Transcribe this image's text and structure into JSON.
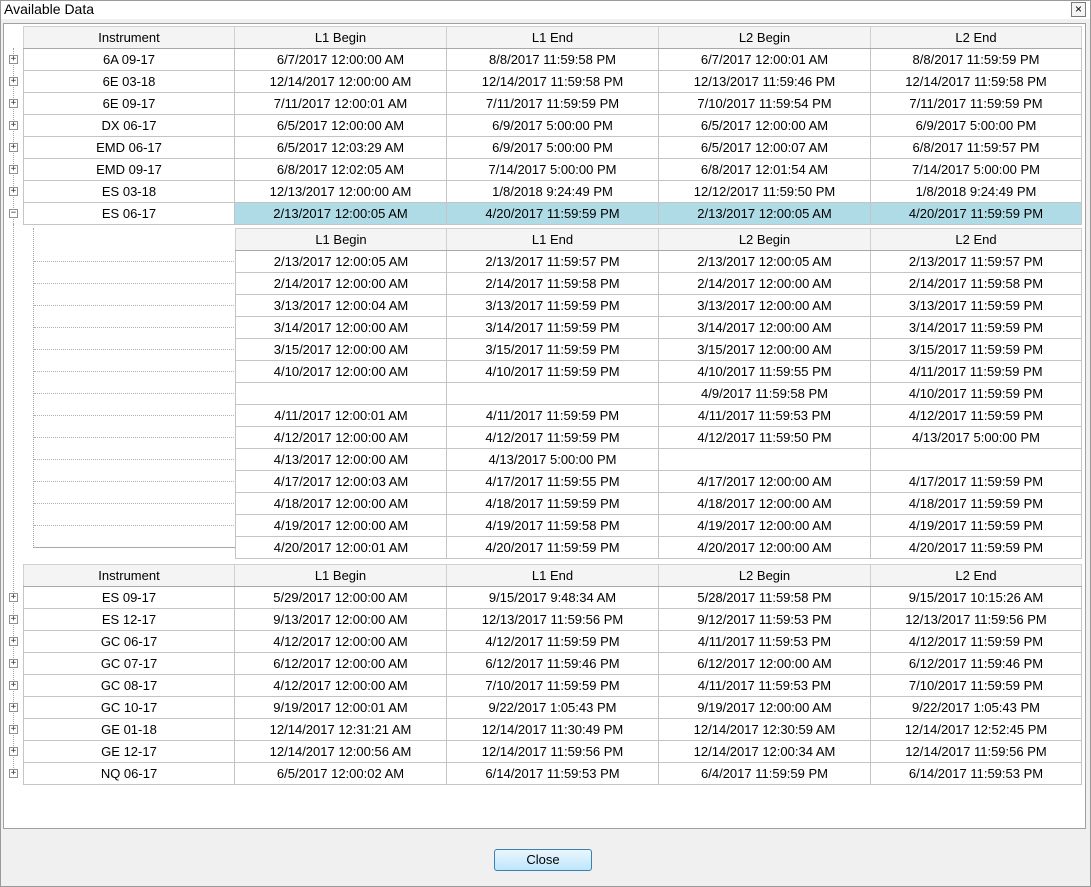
{
  "window": {
    "title": "Available Data",
    "close_glyph": "×"
  },
  "columns": [
    "Instrument",
    "L1 Begin",
    "L1 End",
    "L2 Begin",
    "L2 End"
  ],
  "child_columns": [
    "L1 Begin",
    "L1 End",
    "L2 Begin",
    "L2 End"
  ],
  "rows_top": [
    [
      "6A 09-17",
      "6/7/2017 12:00:00 AM",
      "8/8/2017 11:59:58 PM",
      "6/7/2017 12:00:01 AM",
      "8/8/2017 11:59:59 PM"
    ],
    [
      "6E 03-18",
      "12/14/2017 12:00:00 AM",
      "12/14/2017 11:59:58 PM",
      "12/13/2017 11:59:46 PM",
      "12/14/2017 11:59:58 PM"
    ],
    [
      "6E 09-17",
      "7/11/2017 12:00:01 AM",
      "7/11/2017 11:59:59 PM",
      "7/10/2017 11:59:54 PM",
      "7/11/2017 11:59:59 PM"
    ],
    [
      "DX 06-17",
      "6/5/2017 12:00:00 AM",
      "6/9/2017 5:00:00 PM",
      "6/5/2017 12:00:00 AM",
      "6/9/2017 5:00:00 PM"
    ],
    [
      "EMD 06-17",
      "6/5/2017 12:03:29 AM",
      "6/9/2017 5:00:00 PM",
      "6/5/2017 12:00:07 AM",
      "6/8/2017 11:59:57 PM"
    ],
    [
      "EMD 09-17",
      "6/8/2017 12:02:05 AM",
      "7/14/2017 5:00:00 PM",
      "6/8/2017 12:01:54 AM",
      "7/14/2017 5:00:00 PM"
    ],
    [
      "ES 03-18",
      "12/13/2017 12:00:00 AM",
      "1/8/2018 9:24:49 PM",
      "12/12/2017 11:59:50 PM",
      "1/8/2018 9:24:49 PM"
    ],
    [
      "ES 06-17",
      "2/13/2017 12:00:05 AM",
      "4/20/2017 11:59:59 PM",
      "2/13/2017 12:00:05 AM",
      "4/20/2017 11:59:59 PM"
    ]
  ],
  "selected_row_index": 7,
  "child_rows": [
    [
      "2/13/2017 12:00:05 AM",
      "2/13/2017 11:59:57 PM",
      "2/13/2017 12:00:05 AM",
      "2/13/2017 11:59:57 PM"
    ],
    [
      "2/14/2017 12:00:00 AM",
      "2/14/2017 11:59:58 PM",
      "2/14/2017 12:00:00 AM",
      "2/14/2017 11:59:58 PM"
    ],
    [
      "3/13/2017 12:00:04 AM",
      "3/13/2017 11:59:59 PM",
      "3/13/2017 12:00:00 AM",
      "3/13/2017 11:59:59 PM"
    ],
    [
      "3/14/2017 12:00:00 AM",
      "3/14/2017 11:59:59 PM",
      "3/14/2017 12:00:00 AM",
      "3/14/2017 11:59:59 PM"
    ],
    [
      "3/15/2017 12:00:00 AM",
      "3/15/2017 11:59:59 PM",
      "3/15/2017 12:00:00 AM",
      "3/15/2017 11:59:59 PM"
    ],
    [
      "4/10/2017 12:00:00 AM",
      "4/10/2017 11:59:59 PM",
      "4/10/2017 11:59:55 PM",
      "4/11/2017 11:59:59 PM"
    ],
    [
      "",
      "",
      "4/9/2017 11:59:58 PM",
      "4/10/2017 11:59:59 PM"
    ],
    [
      "4/11/2017 12:00:01 AM",
      "4/11/2017 11:59:59 PM",
      "4/11/2017 11:59:53 PM",
      "4/12/2017 11:59:59 PM"
    ],
    [
      "4/12/2017 12:00:00 AM",
      "4/12/2017 11:59:59 PM",
      "4/12/2017 11:59:50 PM",
      "4/13/2017 5:00:00 PM"
    ],
    [
      "4/13/2017 12:00:00 AM",
      "4/13/2017 5:00:00 PM",
      "",
      ""
    ],
    [
      "4/17/2017 12:00:03 AM",
      "4/17/2017 11:59:55 PM",
      "4/17/2017 12:00:00 AM",
      "4/17/2017 11:59:59 PM"
    ],
    [
      "4/18/2017 12:00:00 AM",
      "4/18/2017 11:59:59 PM",
      "4/18/2017 12:00:00 AM",
      "4/18/2017 11:59:59 PM"
    ],
    [
      "4/19/2017 12:00:00 AM",
      "4/19/2017 11:59:58 PM",
      "4/19/2017 12:00:00 AM",
      "4/19/2017 11:59:59 PM"
    ],
    [
      "4/20/2017 12:00:01 AM",
      "4/20/2017 11:59:59 PM",
      "4/20/2017 12:00:00 AM",
      "4/20/2017 11:59:59 PM"
    ]
  ],
  "rows_bottom": [
    [
      "ES 09-17",
      "5/29/2017 12:00:00 AM",
      "9/15/2017 9:48:34 AM",
      "5/28/2017 11:59:58 PM",
      "9/15/2017 10:15:26 AM"
    ],
    [
      "ES 12-17",
      "9/13/2017 12:00:00 AM",
      "12/13/2017 11:59:56 PM",
      "9/12/2017 11:59:53 PM",
      "12/13/2017 11:59:56 PM"
    ],
    [
      "GC 06-17",
      "4/12/2017 12:00:00 AM",
      "4/12/2017 11:59:59 PM",
      "4/11/2017 11:59:53 PM",
      "4/12/2017 11:59:59 PM"
    ],
    [
      "GC 07-17",
      "6/12/2017 12:00:00 AM",
      "6/12/2017 11:59:46 PM",
      "6/12/2017 12:00:00 AM",
      "6/12/2017 11:59:46 PM"
    ],
    [
      "GC 08-17",
      "4/12/2017 12:00:00 AM",
      "7/10/2017 11:59:59 PM",
      "4/11/2017 11:59:53 PM",
      "7/10/2017 11:59:59 PM"
    ],
    [
      "GC 10-17",
      "9/19/2017 12:00:01 AM",
      "9/22/2017 1:05:43 PM",
      "9/19/2017 12:00:00 AM",
      "9/22/2017 1:05:43 PM"
    ],
    [
      "GE 01-18",
      "12/14/2017 12:31:21 AM",
      "12/14/2017 11:30:49 PM",
      "12/14/2017 12:30:59 AM",
      "12/14/2017 12:52:45 PM"
    ],
    [
      "GE 12-17",
      "12/14/2017 12:00:56 AM",
      "12/14/2017 11:59:56 PM",
      "12/14/2017 12:00:34 AM",
      "12/14/2017 11:59:56 PM"
    ],
    [
      "NQ 06-17",
      "6/5/2017 12:00:02 AM",
      "6/14/2017 11:59:53 PM",
      "6/4/2017 11:59:59 PM",
      "6/14/2017 11:59:53 PM"
    ]
  ],
  "expander": {
    "collapsed": "+",
    "expanded": "−"
  },
  "footer": {
    "close_label": "Close"
  }
}
